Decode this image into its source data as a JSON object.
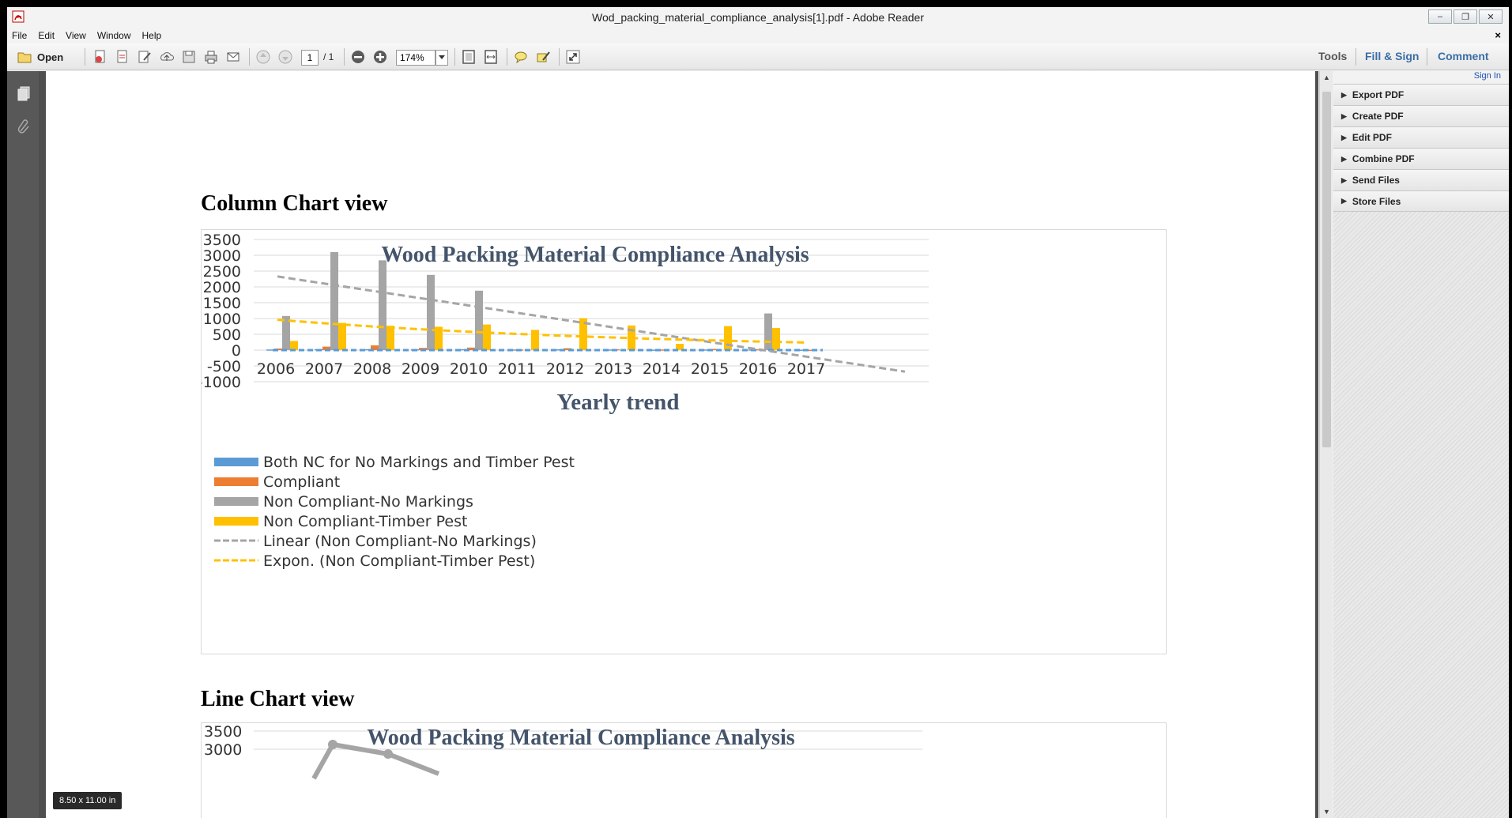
{
  "window": {
    "title": "Wod_packing_material_compliance_analysis[1].pdf - Adobe Reader",
    "controls": {
      "minimize": "‒",
      "restore": "❐",
      "close": "✕"
    }
  },
  "menu": {
    "items": [
      "File",
      "Edit",
      "View",
      "Window",
      "Help"
    ],
    "close_doc": "×"
  },
  "toolbar": {
    "open_label": "Open",
    "page_current": "1",
    "page_total": "/ 1",
    "zoom": "174%",
    "tools_label": "Tools",
    "fill_sign_label": "Fill & Sign",
    "comment_label": "Comment"
  },
  "right_panel": {
    "sign_in": "Sign In",
    "items": [
      "Export PDF",
      "Create PDF",
      "Edit PDF",
      "Combine PDF",
      "Send Files",
      "Store Files"
    ]
  },
  "document": {
    "heading_column": "Column Chart view",
    "heading_line": "Line Chart view",
    "page_size": "8.50 x 11.00 in"
  },
  "colors": {
    "both_nc": "#5b9bd5",
    "compliant": "#ed7d31",
    "no_markings": "#a5a5a5",
    "timber_pest": "#ffc000"
  },
  "chart_data": [
    {
      "type": "bar",
      "title": "Wood Packing Material Compliance Analysis",
      "xlabel": "Yearly trend",
      "ylabel": "",
      "ylim": [
        -1000,
        3500
      ],
      "yticks": [
        "3500",
        "3000",
        "2500",
        "2000",
        "1500",
        "1000",
        "500",
        "0",
        "-500",
        "-1000"
      ],
      "categories": [
        "2006",
        "2007",
        "2008",
        "2009",
        "2010",
        "2011",
        "2012",
        "2013",
        "2014",
        "2015",
        "2016",
        "2017"
      ],
      "series": [
        {
          "name": "Both NC for No Markings and Timber Pest",
          "values": [
            20,
            30,
            30,
            25,
            30,
            20,
            25,
            20,
            15,
            20,
            20,
            15
          ]
        },
        {
          "name": "Compliant",
          "values": [
            50,
            110,
            150,
            70,
            80,
            20,
            60,
            30,
            20,
            40,
            30,
            10
          ]
        },
        {
          "name": "Non Compliant-No Markings",
          "values": [
            1080,
            3100,
            2840,
            2380,
            1880,
            0,
            0,
            0,
            0,
            0,
            1160,
            0
          ]
        },
        {
          "name": "Non Compliant-Timber Pest",
          "values": [
            290,
            860,
            770,
            740,
            810,
            640,
            1010,
            780,
            200,
            760,
            700,
            0
          ]
        }
      ],
      "trendlines": [
        {
          "name": "Linear (Non Compliant-No Markings)",
          "type": "linear",
          "start": 2330,
          "end": -680
        },
        {
          "name": "Expon. (Non Compliant-Timber Pest)",
          "type": "exponential",
          "start": 960,
          "end": 240
        }
      ],
      "legend": "bottom"
    },
    {
      "type": "line",
      "title": "Wood Packing Material Compliance Analysis",
      "yticks_visible": [
        "3500",
        "3000"
      ],
      "partial": true,
      "visible_points": [
        3100,
        2840
      ]
    }
  ]
}
